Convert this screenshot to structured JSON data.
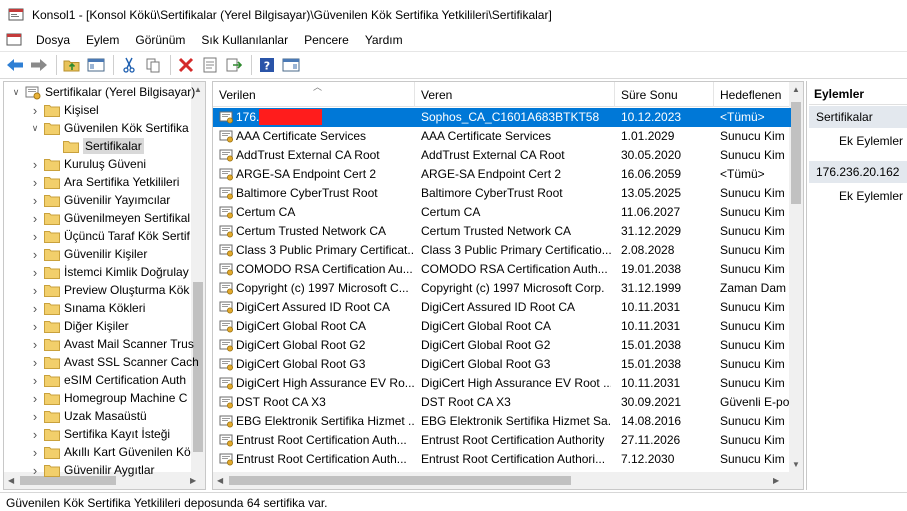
{
  "window": {
    "title": "Konsol1 - [Konsol Kökü\\Sertifikalar (Yerel Bilgisayar)\\Güvenilen Kök Sertifika Yetkilileri\\Sertifikalar]"
  },
  "menu": [
    "Dosya",
    "Eylem",
    "Görünüm",
    "Sık Kullanılanlar",
    "Pencere",
    "Yardım"
  ],
  "toolbar": {
    "buttons": [
      "back-arrow-icon",
      "forward-arrow-icon",
      "up-folder-icon",
      "show-tree-icon",
      "cut-icon",
      "copy-icon",
      "delete-icon",
      "properties-icon",
      "export-icon",
      "help-icon",
      "show-action-pane-icon"
    ]
  },
  "tree": {
    "items": [
      {
        "label": "Sertifikalar (Yerel Bilgisayar)",
        "indent": 0,
        "expander": "expanded",
        "icon": "certificate-store-icon"
      },
      {
        "label": "Kişisel",
        "indent": 1,
        "expander": "collapsed",
        "icon": "folder-icon"
      },
      {
        "label": "Güvenilen Kök Sertifika",
        "indent": 1,
        "expander": "expanded",
        "icon": "folder-icon"
      },
      {
        "label": "Sertifikalar",
        "indent": 2,
        "expander": "none",
        "icon": "folder-icon",
        "selected": true
      },
      {
        "label": "Kuruluş Güveni",
        "indent": 1,
        "expander": "collapsed",
        "icon": "folder-icon"
      },
      {
        "label": "Ara Sertifika Yetkilileri",
        "indent": 1,
        "expander": "collapsed",
        "icon": "folder-icon"
      },
      {
        "label": "Güvenilir Yayımcılar",
        "indent": 1,
        "expander": "collapsed",
        "icon": "folder-icon"
      },
      {
        "label": "Güvenilmeyen Sertifikal",
        "indent": 1,
        "expander": "collapsed",
        "icon": "folder-icon"
      },
      {
        "label": "Üçüncü Taraf Kök Sertif",
        "indent": 1,
        "expander": "collapsed",
        "icon": "folder-icon"
      },
      {
        "label": "Güvenilir Kişiler",
        "indent": 1,
        "expander": "collapsed",
        "icon": "folder-icon"
      },
      {
        "label": "İstemci Kimlik Doğrulay",
        "indent": 1,
        "expander": "collapsed",
        "icon": "folder-icon"
      },
      {
        "label": "Preview Oluşturma Kök",
        "indent": 1,
        "expander": "collapsed",
        "icon": "folder-icon"
      },
      {
        "label": "Sınama Kökleri",
        "indent": 1,
        "expander": "collapsed",
        "icon": "folder-icon"
      },
      {
        "label": "Diğer Kişiler",
        "indent": 1,
        "expander": "collapsed",
        "icon": "folder-icon"
      },
      {
        "label": "Avast Mail Scanner Trus",
        "indent": 1,
        "expander": "collapsed",
        "icon": "folder-icon"
      },
      {
        "label": "Avast SSL Scanner Cach",
        "indent": 1,
        "expander": "collapsed",
        "icon": "folder-icon"
      },
      {
        "label": "eSIM Certification Auth",
        "indent": 1,
        "expander": "collapsed",
        "icon": "folder-icon"
      },
      {
        "label": "Homegroup Machine C",
        "indent": 1,
        "expander": "collapsed",
        "icon": "folder-icon"
      },
      {
        "label": "Uzak Masaüstü",
        "indent": 1,
        "expander": "collapsed",
        "icon": "folder-icon"
      },
      {
        "label": "Sertifika Kayıt İsteği",
        "indent": 1,
        "expander": "collapsed",
        "icon": "folder-icon"
      },
      {
        "label": "Akıllı Kart Güvenilen Kö",
        "indent": 1,
        "expander": "collapsed",
        "icon": "folder-icon"
      },
      {
        "label": "Güvenilir Aygıtlar",
        "indent": 1,
        "expander": "collapsed",
        "icon": "folder-icon"
      }
    ]
  },
  "list": {
    "columns": [
      "Verilen",
      "Veren",
      "Süre Sonu",
      "Hedeflenen"
    ],
    "rows": [
      {
        "verilen": "176.",
        "veren": "Sophos_CA_C1601A683BTKT58",
        "sure": "10.12.2023",
        "hedef": "<Tümü>",
        "selected": true,
        "redacted": true
      },
      {
        "verilen": "AAA Certificate Services",
        "veren": "AAA Certificate Services",
        "sure": "1.01.2029",
        "hedef": "Sunucu Kim"
      },
      {
        "verilen": "AddTrust External CA Root",
        "veren": "AddTrust External CA Root",
        "sure": "30.05.2020",
        "hedef": "Sunucu Kim"
      },
      {
        "verilen": "ARGE-SA Endpoint Cert 2",
        "veren": "ARGE-SA Endpoint Cert 2",
        "sure": "16.06.2059",
        "hedef": "<Tümü>"
      },
      {
        "verilen": "Baltimore CyberTrust Root",
        "veren": "Baltimore CyberTrust Root",
        "sure": "13.05.2025",
        "hedef": "Sunucu Kim"
      },
      {
        "verilen": "Certum CA",
        "veren": "Certum CA",
        "sure": "11.06.2027",
        "hedef": "Sunucu Kim"
      },
      {
        "verilen": "Certum Trusted Network CA",
        "veren": "Certum Trusted Network CA",
        "sure": "31.12.2029",
        "hedef": "Sunucu Kim"
      },
      {
        "verilen": "Class 3 Public Primary Certificat...",
        "veren": "Class 3 Public Primary Certificatio...",
        "sure": "2.08.2028",
        "hedef": "Sunucu Kim"
      },
      {
        "verilen": "COMODO RSA Certification Au...",
        "veren": "COMODO RSA Certification Auth...",
        "sure": "19.01.2038",
        "hedef": "Sunucu Kim"
      },
      {
        "verilen": "Copyright (c) 1997 Microsoft C...",
        "veren": "Copyright (c) 1997 Microsoft Corp.",
        "sure": "31.12.1999",
        "hedef": "Zaman Dam"
      },
      {
        "verilen": "DigiCert Assured ID Root CA",
        "veren": "DigiCert Assured ID Root CA",
        "sure": "10.11.2031",
        "hedef": "Sunucu Kim"
      },
      {
        "verilen": "DigiCert Global Root CA",
        "veren": "DigiCert Global Root CA",
        "sure": "10.11.2031",
        "hedef": "Sunucu Kim"
      },
      {
        "verilen": "DigiCert Global Root G2",
        "veren": "DigiCert Global Root G2",
        "sure": "15.01.2038",
        "hedef": "Sunucu Kim"
      },
      {
        "verilen": "DigiCert Global Root G3",
        "veren": "DigiCert Global Root G3",
        "sure": "15.01.2038",
        "hedef": "Sunucu Kim"
      },
      {
        "verilen": "DigiCert High Assurance EV Ro...",
        "veren": "DigiCert High Assurance EV Root ...",
        "sure": "10.11.2031",
        "hedef": "Sunucu Kim"
      },
      {
        "verilen": "DST Root CA X3",
        "veren": "DST Root CA X3",
        "sure": "30.09.2021",
        "hedef": "Güvenli E-po"
      },
      {
        "verilen": "EBG Elektronik Sertifika Hizmet ...",
        "veren": "EBG Elektronik Sertifika Hizmet Sa...",
        "sure": "14.08.2016",
        "hedef": "Sunucu Kim"
      },
      {
        "verilen": "Entrust Root Certification Auth...",
        "veren": "Entrust Root Certification Authority",
        "sure": "27.11.2026",
        "hedef": "Sunucu Kim"
      },
      {
        "verilen": "Entrust Root Certification Auth...",
        "veren": "Entrust Root Certification Authori...",
        "sure": "7.12.2030",
        "hedef": "Sunucu Kim"
      }
    ]
  },
  "actions": {
    "header": "Eylemler",
    "sections": [
      {
        "title": "Sertifikalar",
        "item": "Ek Eylemler"
      },
      {
        "title": "176.236.20.162",
        "item": "Ek Eylemler"
      }
    ]
  },
  "status": "Güvenilen Kök Sertifika Yetkilileri deposunda 64 sertifika var.",
  "colors": {
    "selection": "#0078d7",
    "redaction": "#ff1c1c",
    "actions_section": "#e3e8ee"
  }
}
